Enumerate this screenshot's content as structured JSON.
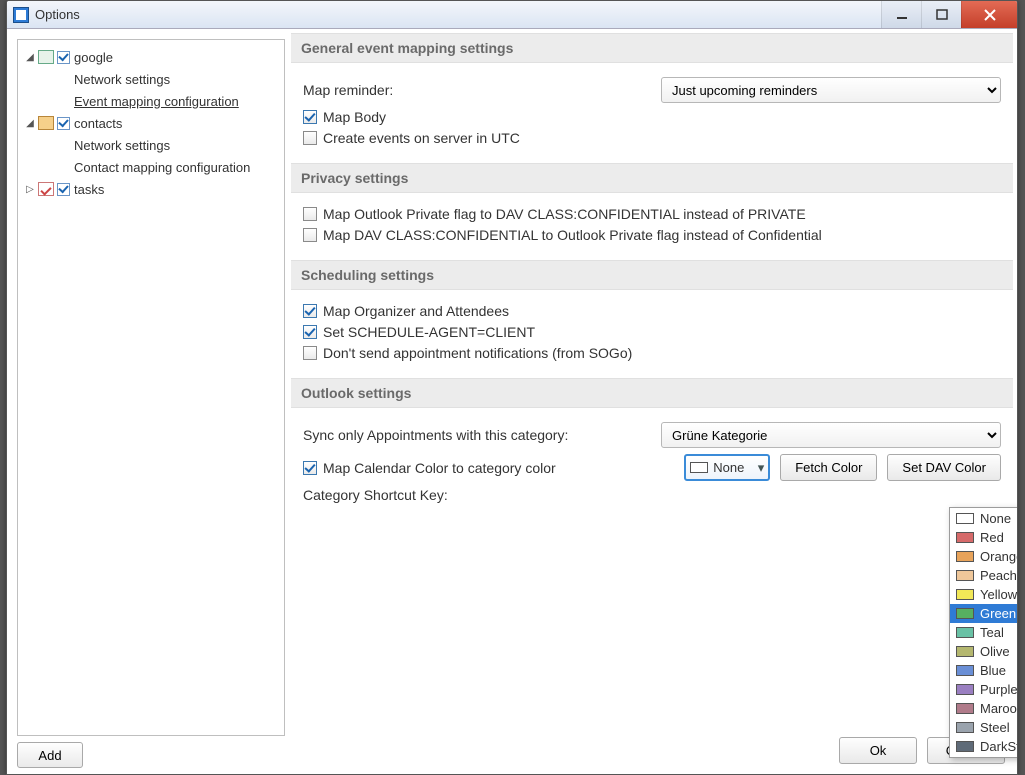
{
  "window": {
    "title": "Options"
  },
  "tree": {
    "items": [
      {
        "label": "google",
        "icon": "cal",
        "checked": true,
        "expanded": true,
        "depth": 0,
        "hasArrow": true
      },
      {
        "label": "Network settings",
        "depth": 1
      },
      {
        "label": "Event mapping configuration",
        "depth": 1,
        "selected": true
      },
      {
        "label": "contacts",
        "icon": "people",
        "checked": true,
        "expanded": true,
        "depth": 0,
        "hasArrow": true
      },
      {
        "label": "Network settings",
        "depth": 1
      },
      {
        "label": "Contact mapping configuration",
        "depth": 1
      },
      {
        "label": "tasks",
        "icon": "tasks",
        "checked": true,
        "expanded": false,
        "depth": 0,
        "hasArrow": true
      }
    ],
    "add_button": "Add"
  },
  "sections": {
    "general": {
      "title": "General event mapping settings",
      "map_reminder_label": "Map reminder:",
      "map_reminder_value": "Just upcoming reminders",
      "map_body": {
        "label": "Map Body",
        "checked": true
      },
      "create_utc": {
        "label": "Create events on server in UTC",
        "checked": false
      }
    },
    "privacy": {
      "title": "Privacy settings",
      "opt1": {
        "label": "Map Outlook Private flag to DAV CLASS:CONFIDENTIAL instead of PRIVATE",
        "checked": false
      },
      "opt2": {
        "label": "Map DAV CLASS:CONFIDENTIAL to Outlook Private flag instead of Confidential",
        "checked": false
      }
    },
    "scheduling": {
      "title": "Scheduling settings",
      "opt1": {
        "label": "Map Organizer and Attendees",
        "checked": true
      },
      "opt2": {
        "label": "Set SCHEDULE-AGENT=CLIENT",
        "checked": true
      },
      "opt3": {
        "label": "Don't send appointment notifications (from SOGo)",
        "checked": false
      }
    },
    "outlook": {
      "title": "Outlook settings",
      "sync_category_label": "Sync only Appointments with this category:",
      "sync_category_value": "Grüne Kategorie",
      "map_color": {
        "label": "Map Calendar Color to category color",
        "checked": true
      },
      "shortcut_label": "Category Shortcut Key:",
      "color_selected": "None",
      "fetch_color": "Fetch Color",
      "set_dav_color": "Set DAV Color"
    }
  },
  "color_dropdown": {
    "options": [
      {
        "name": "None",
        "hex": "#ffffff"
      },
      {
        "name": "Red",
        "hex": "#d66a6a"
      },
      {
        "name": "Orange",
        "hex": "#e8a35a"
      },
      {
        "name": "Peach",
        "hex": "#efc79a"
      },
      {
        "name": "Yellow",
        "hex": "#f2e857"
      },
      {
        "name": "Green",
        "hex": "#57b060",
        "selected": true
      },
      {
        "name": "Teal",
        "hex": "#69c1a5"
      },
      {
        "name": "Olive",
        "hex": "#b4b76f"
      },
      {
        "name": "Blue",
        "hex": "#6a8fd6"
      },
      {
        "name": "Purple",
        "hex": "#9a7fc1"
      },
      {
        "name": "Maroon",
        "hex": "#b07b8a"
      },
      {
        "name": "Steel",
        "hex": "#9aa3ad"
      },
      {
        "name": "DarkSteel",
        "hex": "#5f6b78"
      }
    ]
  },
  "footer": {
    "ok": "Ok",
    "cancel": "Cancel"
  }
}
